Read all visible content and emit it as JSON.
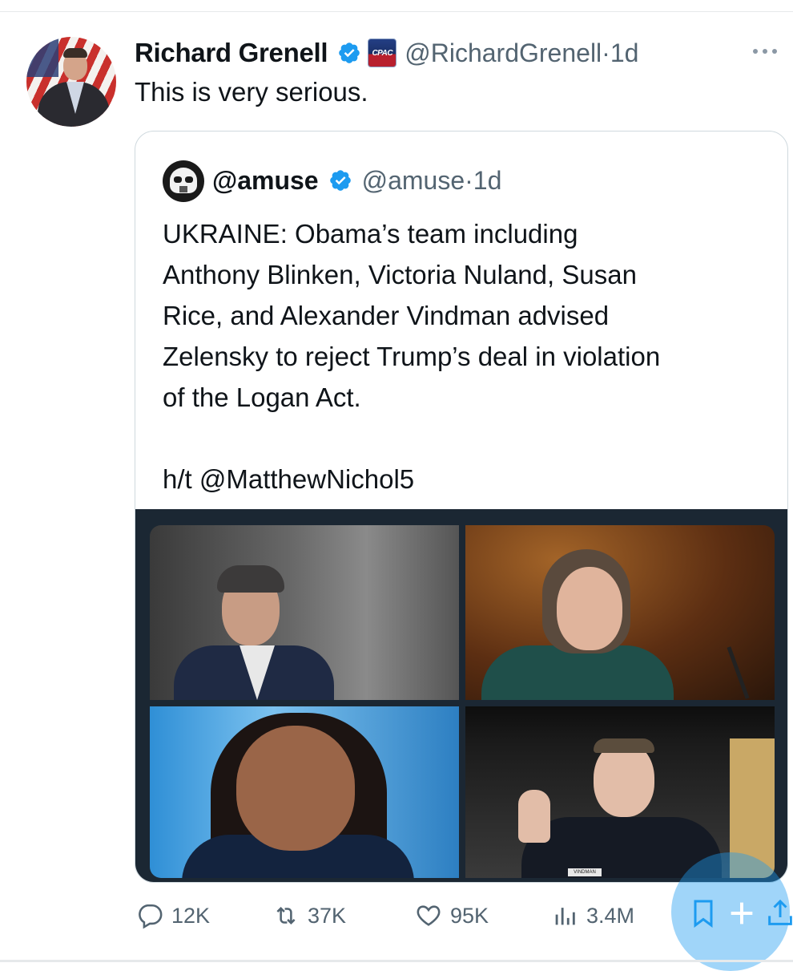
{
  "tweet": {
    "author_name": "Richard Grenell",
    "org_badge": "CPAC",
    "handle": "@RichardGrenell",
    "separator": "·",
    "time": "1d",
    "text": "This is very serious."
  },
  "quoted_tweet": {
    "author_name": "@amuse",
    "handle": "@amuse",
    "separator": "·",
    "time": "1d",
    "text_lines": [
      "UKRAINE: Obama’s team including",
      "Anthony Blinken, Victoria Nuland, Susan",
      "Rice, and Alexander Vindman advised",
      "Zelensky to reject Trump’s deal in violation",
      "of the Logan Act."
    ],
    "hat_tip": "h/t @MatthewNichol5",
    "media_caption_tag": "VINDMAN"
  },
  "actions": {
    "replies": "12K",
    "reposts": "37K",
    "likes": "95K",
    "views": "3.4M"
  },
  "colors": {
    "text": "#0f1419",
    "secondary": "#536471",
    "verified": "#1d9bf0",
    "border": "#cfd9de"
  },
  "icons": [
    "more-icon",
    "verified-badge-icon",
    "reply-icon",
    "repost-icon",
    "like-icon",
    "views-icon",
    "bookmark-icon",
    "share-icon",
    "compose-plus-icon"
  ]
}
